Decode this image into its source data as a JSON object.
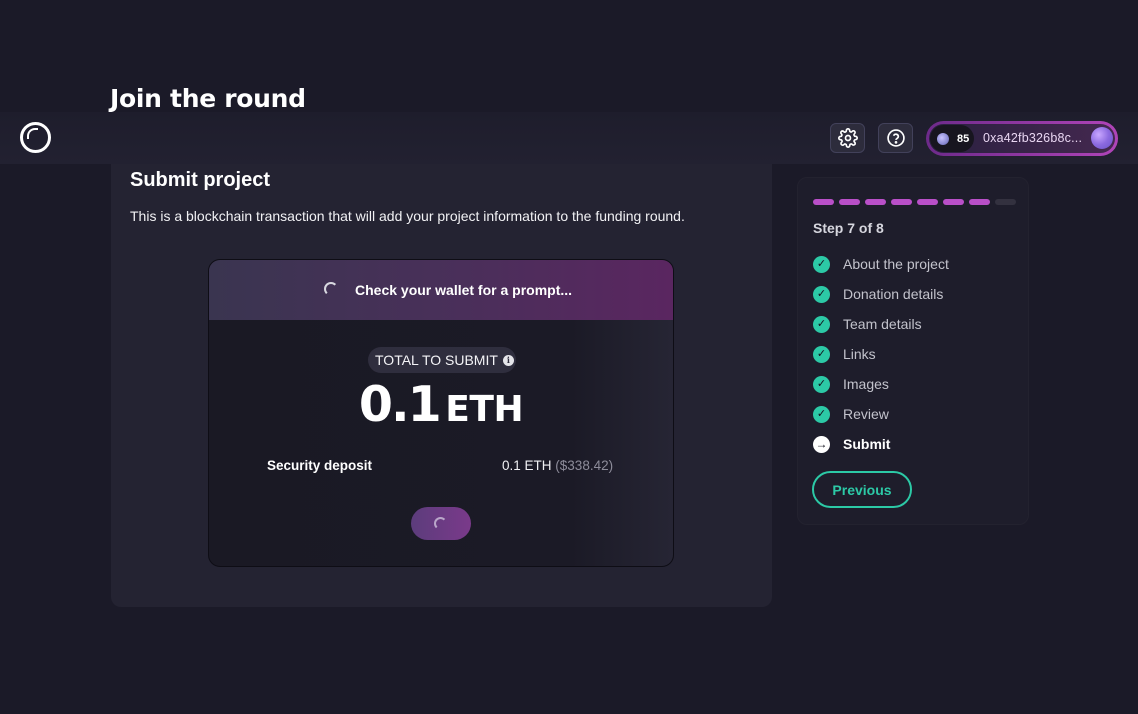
{
  "header": {
    "page_title": "Join the round",
    "balance": "85",
    "wallet_address": "0xa42fb326b8c..."
  },
  "main": {
    "title": "Submit project",
    "description": "This is a blockchain transaction that will add your project information to the funding round.",
    "transaction": {
      "status_text": "Check your wallet for a prompt...",
      "total_label": "TOTAL TO SUBMIT",
      "total_amount": "0.1",
      "total_unit": "ETH",
      "deposit_label": "Security deposit",
      "deposit_value": "0.1 ETH",
      "deposit_fiat": "($338.42)"
    }
  },
  "sidebar": {
    "progress_completed": 7,
    "progress_total": 8,
    "step_label": "Step 7 of 8",
    "steps": [
      {
        "label": "About the project",
        "status": "done"
      },
      {
        "label": "Donation details",
        "status": "done"
      },
      {
        "label": "Team details",
        "status": "done"
      },
      {
        "label": "Links",
        "status": "done"
      },
      {
        "label": "Images",
        "status": "done"
      },
      {
        "label": "Review",
        "status": "done"
      },
      {
        "label": "Submit",
        "status": "current"
      }
    ],
    "previous_label": "Previous"
  },
  "colors": {
    "accent": "#2cc9a6",
    "progress_done": "#b94fc8",
    "progress_todo": "#33313f"
  }
}
